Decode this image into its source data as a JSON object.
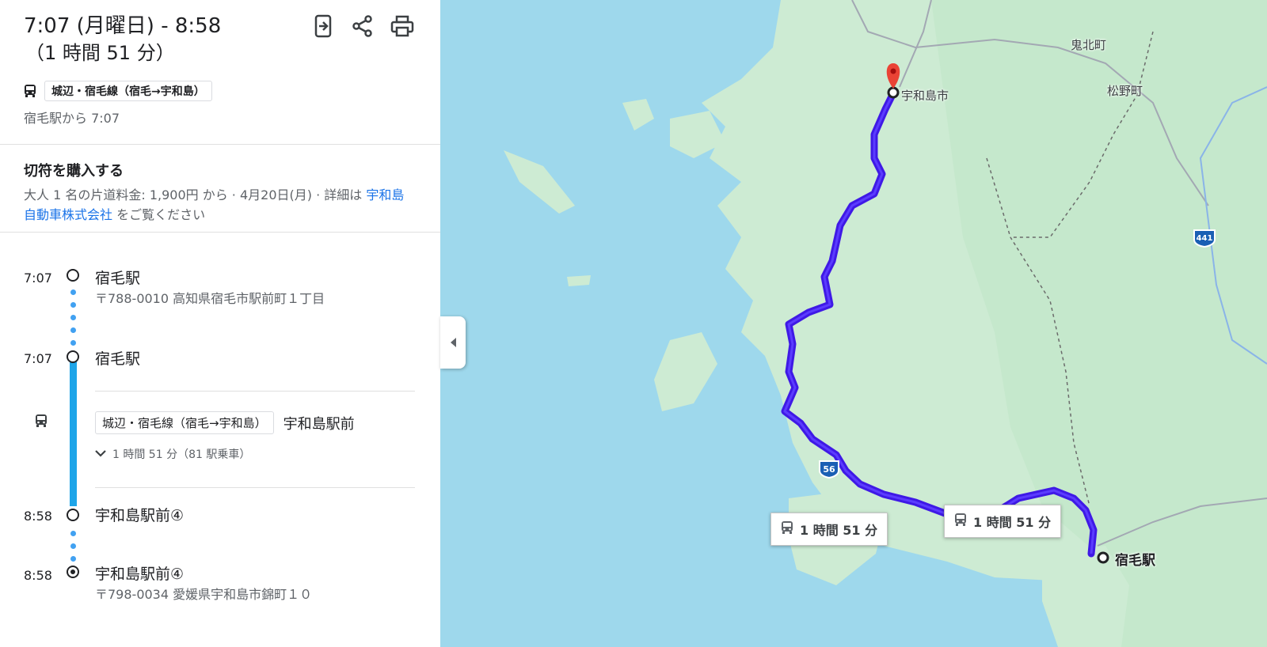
{
  "header": {
    "time_range": "7:07 (月曜日) - 8:58",
    "duration": "（1 時間 51 分）",
    "icons": [
      "send-to-phone-icon",
      "share-icon",
      "print-icon"
    ]
  },
  "route": {
    "chip": "城辺・宿毛線（宿毛→宇和島）",
    "depart": "宿毛駅から 7:07"
  },
  "ticket": {
    "title": "切符を購入する",
    "text": "大人 1 名の片道料金: 1,900円 から · 4月20日(月) · 詳細は ",
    "link": "宇和島自動車株式会社",
    "text_after": " をご覧ください"
  },
  "steps": {
    "s1_time": "7:07",
    "s1_name": "宿毛駅",
    "s1_addr": "〒788-0010 高知県宿毛市駅前町１丁目",
    "s2_time": "7:07",
    "s2_name": "宿毛駅",
    "leg_chip": "城辺・宿毛線（宿毛→宇和島）",
    "leg_dest": "宇和島駅前",
    "leg_detail": "1 時間 51 分（81 駅乗車）",
    "s3_time": "8:58",
    "s3_name": "宇和島駅前④",
    "s4_time": "8:58",
    "s4_name": "宇和島駅前④",
    "s4_addr": "〒798-0034 愛媛県宇和島市錦町１０"
  },
  "map": {
    "labels": {
      "kihoku": "鬼北町",
      "matsuno": "松野町",
      "uwajima": "宇和島市",
      "sukumo": "宿毛駅"
    },
    "route_shields": {
      "r56": "56",
      "r441": "441"
    },
    "tooltip1": "1 時間 51 分",
    "tooltip2": "1 時間 51 分",
    "colors": {
      "route": "#3f19e6",
      "sea": "#9ed8ec",
      "land": "#cdebd3",
      "transit_line": "#1ea5e9"
    }
  }
}
